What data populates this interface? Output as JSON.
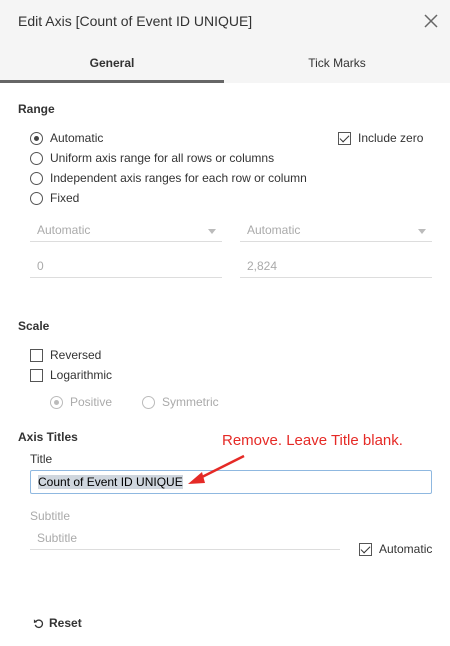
{
  "dialog": {
    "title": "Edit Axis [Count of Event ID UNIQUE]"
  },
  "tabs": [
    {
      "label": "General"
    },
    {
      "label": "Tick Marks"
    }
  ],
  "range": {
    "heading": "Range",
    "options": [
      {
        "label": "Automatic",
        "selected": true
      },
      {
        "label": "Uniform axis range for all rows or columns",
        "selected": false
      },
      {
        "label": "Independent axis ranges for each row or column",
        "selected": false
      },
      {
        "label": "Fixed",
        "selected": false
      }
    ],
    "include_zero": {
      "label": "Include zero",
      "checked": true
    },
    "start_mode": "Automatic",
    "end_mode": "Automatic",
    "start_value": "0",
    "end_value": "2,824"
  },
  "scale": {
    "heading": "Scale",
    "reversed": {
      "label": "Reversed",
      "checked": false
    },
    "logarithmic": {
      "label": "Logarithmic",
      "checked": false
    },
    "positive": {
      "label": "Positive",
      "selected": true
    },
    "symmetric": {
      "label": "Symmetric",
      "selected": false
    }
  },
  "axis_titles": {
    "heading": "Axis Titles",
    "title_label": "Title",
    "title_value": "Count of Event ID UNIQUE",
    "subtitle_label": "Subtitle",
    "subtitle_placeholder": "Subtitle",
    "automatic": {
      "label": "Automatic",
      "checked": true
    }
  },
  "annotation": {
    "text": "Remove. Leave Title blank.",
    "color": "#e52a26"
  },
  "footer": {
    "reset_label": "Reset"
  }
}
